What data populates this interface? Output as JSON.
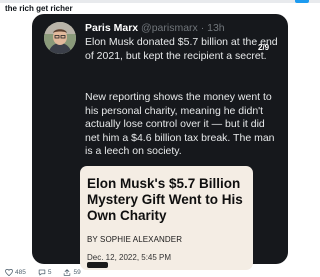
{
  "header": {
    "text": "the rich get richer"
  },
  "tweet": {
    "author_name": "Paris Marx",
    "handle_time": "@parismarx · 13h",
    "counter": "2/9",
    "paragraph1": "Elon Musk donated $5.7 billion at the end of 2021, but kept the recipient a secret.",
    "paragraph2": "New reporting shows the money went to his personal charity, meaning he didn't actually lose control over it — but it did net him a $4.6 billion tax break. The man is a leech on society."
  },
  "article": {
    "headline": "Elon Musk's $5.7 Billion Mystery Gift Went to His Own Charity",
    "byline": "BY SOPHIE ALEXANDER",
    "date": "Dec. 12, 2022, 5:45 PM"
  },
  "actions": {
    "likes": "485",
    "replies": "5",
    "shares": "59"
  },
  "colors": {
    "card_bg": "#16181c",
    "article_bg": "#f4ede4",
    "accent": "#1d9bf0"
  },
  "icons": [
    "heart-icon",
    "reply-icon",
    "share-icon"
  ]
}
